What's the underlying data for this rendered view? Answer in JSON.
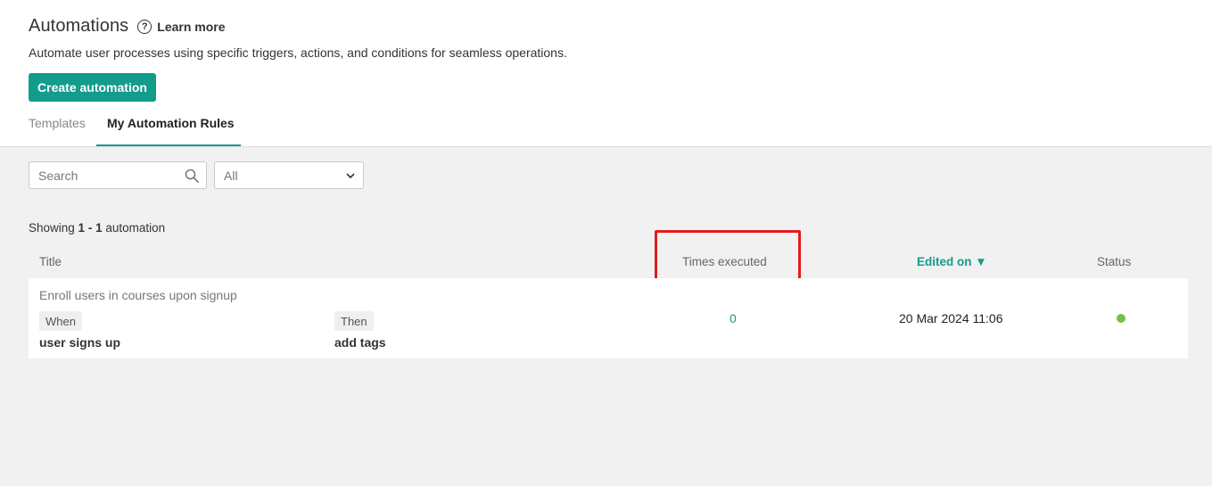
{
  "header": {
    "title": "Automations",
    "learn_more": "Learn more",
    "subtitle": "Automate user processes using specific triggers, actions, and conditions for seamless operations.",
    "create_button": "Create automation"
  },
  "tabs": [
    {
      "label": "Templates",
      "active": false
    },
    {
      "label": "My Automation Rules",
      "active": true
    }
  ],
  "filters": {
    "search_placeholder": "Search",
    "select_value": "All"
  },
  "summary": {
    "prefix": "Showing ",
    "range_start": "1",
    "separator": " - ",
    "range_end": "1",
    "suffix": " automation"
  },
  "table": {
    "columns": {
      "title": "Title",
      "times_executed": "Times executed",
      "edited_on": "Edited on",
      "edited_on_sort": "▼",
      "status": "Status"
    },
    "rows": [
      {
        "title": "Enroll users in courses upon signup",
        "when_label": "When",
        "when_value": "user signs up",
        "then_label": "Then",
        "then_value": "add tags",
        "times_executed": "0",
        "edited_on": "20 Mar 2024 11:06",
        "status_color": "#7ac143"
      }
    ]
  },
  "colors": {
    "accent": "#139b8b",
    "highlight": "#e41b1b"
  }
}
